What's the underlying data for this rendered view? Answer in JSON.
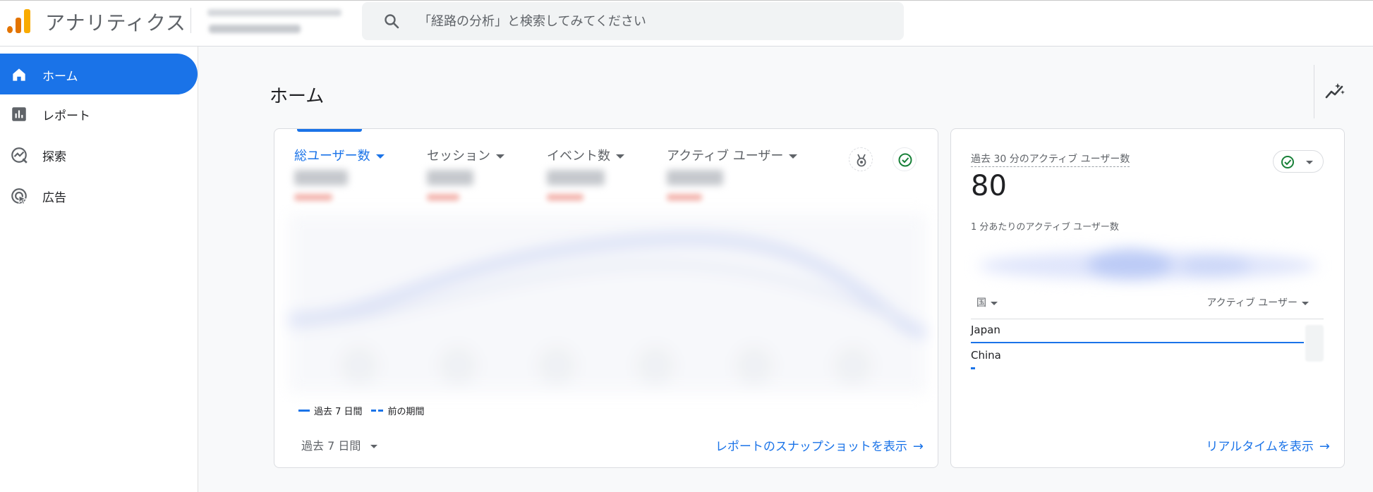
{
  "header": {
    "app_title": "アナリティクス",
    "search_placeholder": "「経路の分析」と検索してみてください"
  },
  "sidebar": {
    "items": [
      {
        "label": "ホーム",
        "icon": "home-icon",
        "active": true
      },
      {
        "label": "レポート",
        "icon": "bar-chart-icon",
        "active": false
      },
      {
        "label": "探索",
        "icon": "explore-icon",
        "active": false
      },
      {
        "label": "広告",
        "icon": "advertising-icon",
        "active": false
      }
    ]
  },
  "page": {
    "title": "ホーム"
  },
  "overview_card": {
    "metrics": [
      {
        "label": "総ユーザー数",
        "active": true
      },
      {
        "label": "セッション",
        "active": false
      },
      {
        "label": "イベント数",
        "active": false
      },
      {
        "label": "アクティブ ユーザー",
        "active": false
      }
    ],
    "legend": {
      "current": "過去 7 日間",
      "previous": "前の期間"
    },
    "date_range": "過去 7 日間",
    "snapshot_link": "レポートのスナップショットを表示",
    "arrow": "→"
  },
  "realtime_card": {
    "title": "過去 30 分のアクティブ ユーザー数",
    "value": "80",
    "per_minute_label": "1 分あたりのアクティブ ユーザー数",
    "dimension_label": "国",
    "metric_label": "アクティブ ユーザー",
    "rows": [
      {
        "country": "Japan",
        "share": 0.94
      },
      {
        "country": "China",
        "share": 0.01
      }
    ],
    "realtime_link": "リアルタイムを表示",
    "arrow": "→"
  },
  "colors": {
    "accent": "#1a73e8",
    "logo_orange": "#e37400",
    "logo_yellow": "#f9ab00",
    "success": "#188038"
  }
}
